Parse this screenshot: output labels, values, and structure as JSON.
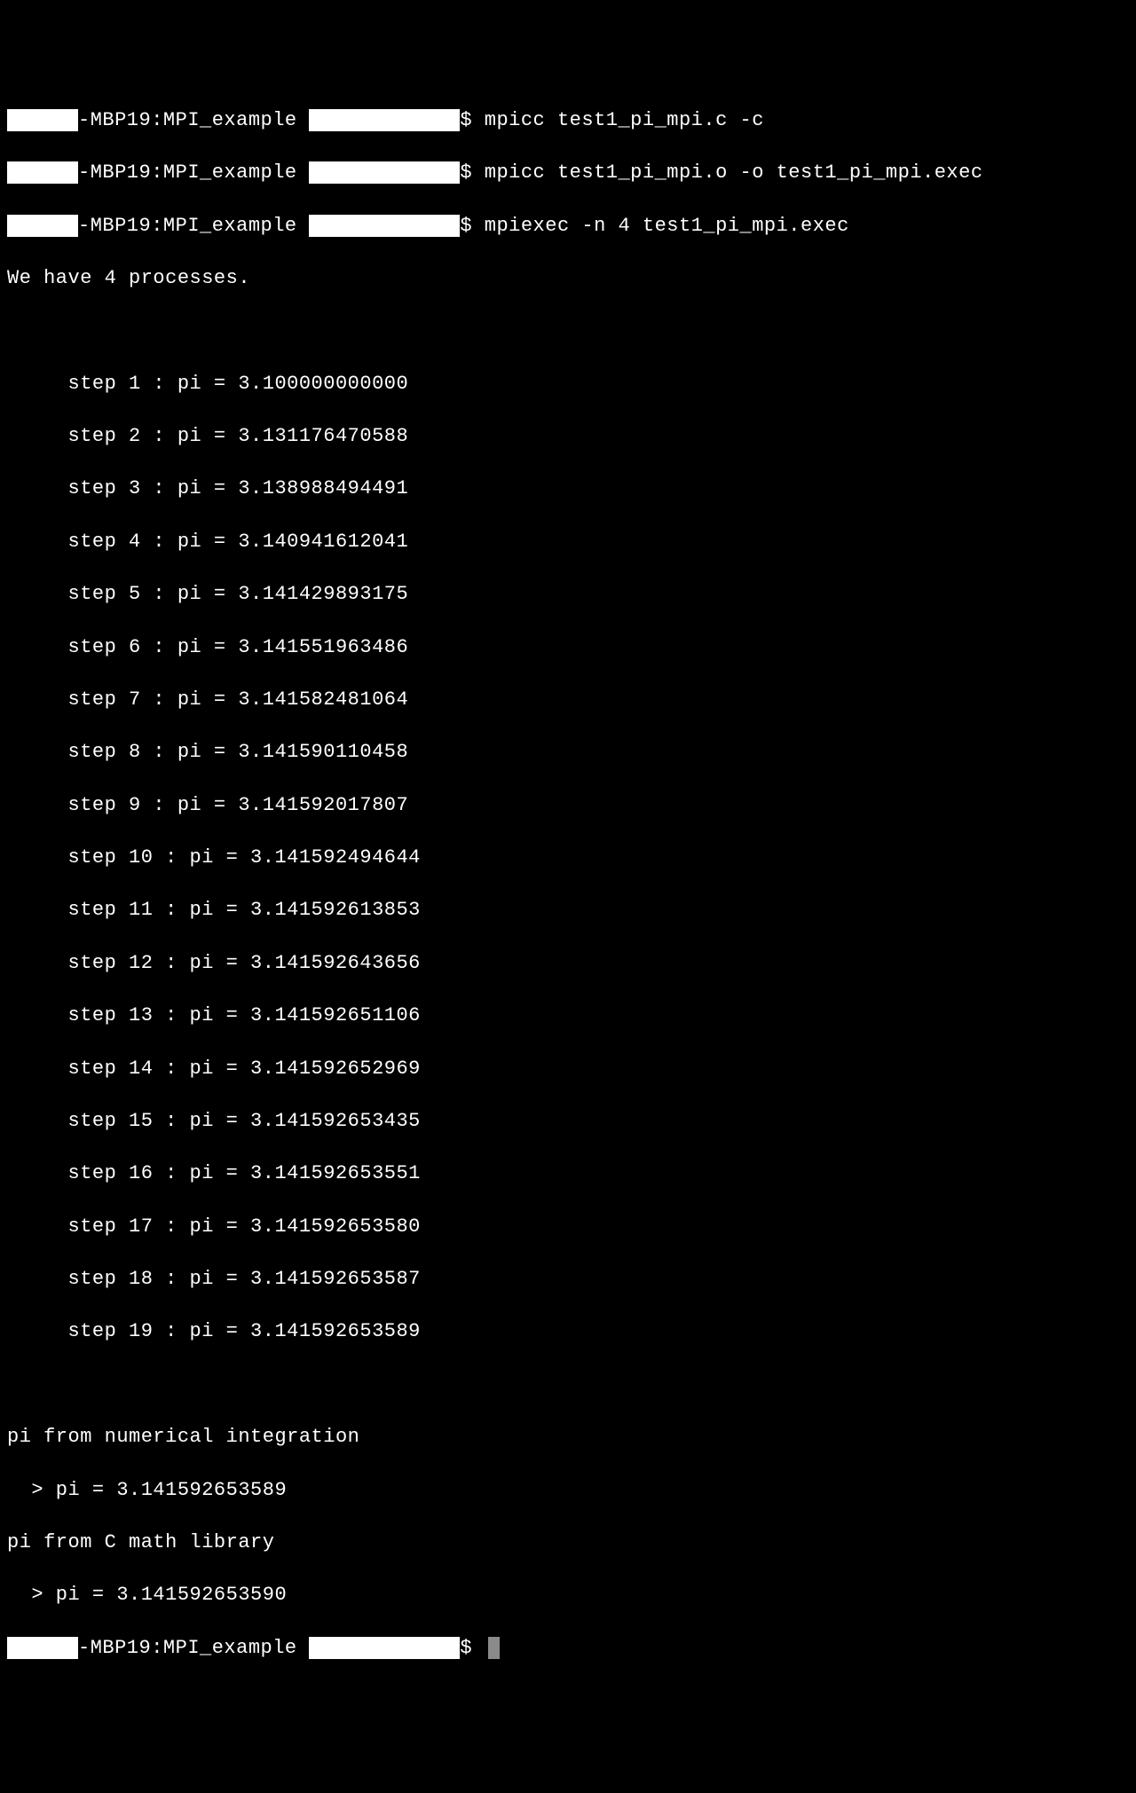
{
  "prompts": {
    "host_path": "-MBP19:MPI_example ",
    "shell_marker": "$ ",
    "commands": [
      "mpicc test1_pi_mpi.c -c",
      "mpicc test1_pi_mpi.o -o test1_pi_mpi.exec",
      "mpiexec -n 4 test1_pi_mpi.exec"
    ]
  },
  "output": {
    "processes_line": "We have 4 processes.",
    "steps": [
      "     step 1 : pi = 3.100000000000",
      "     step 2 : pi = 3.131176470588",
      "     step 3 : pi = 3.138988494491",
      "     step 4 : pi = 3.140941612041",
      "     step 5 : pi = 3.141429893175",
      "     step 6 : pi = 3.141551963486",
      "     step 7 : pi = 3.141582481064",
      "     step 8 : pi = 3.141590110458",
      "     step 9 : pi = 3.141592017807",
      "     step 10 : pi = 3.141592494644",
      "     step 11 : pi = 3.141592613853",
      "     step 12 : pi = 3.141592643656",
      "     step 13 : pi = 3.141592651106",
      "     step 14 : pi = 3.141592652969",
      "     step 15 : pi = 3.141592653435",
      "     step 16 : pi = 3.141592653551",
      "     step 17 : pi = 3.141592653580",
      "     step 18 : pi = 3.141592653587",
      "     step 19 : pi = 3.141592653589"
    ],
    "summary_1_label": "pi from numerical integration",
    "summary_1_value": "  > pi = 3.141592653589",
    "summary_2_label": "pi from C math library",
    "summary_2_value": "  > pi = 3.141592653590"
  }
}
